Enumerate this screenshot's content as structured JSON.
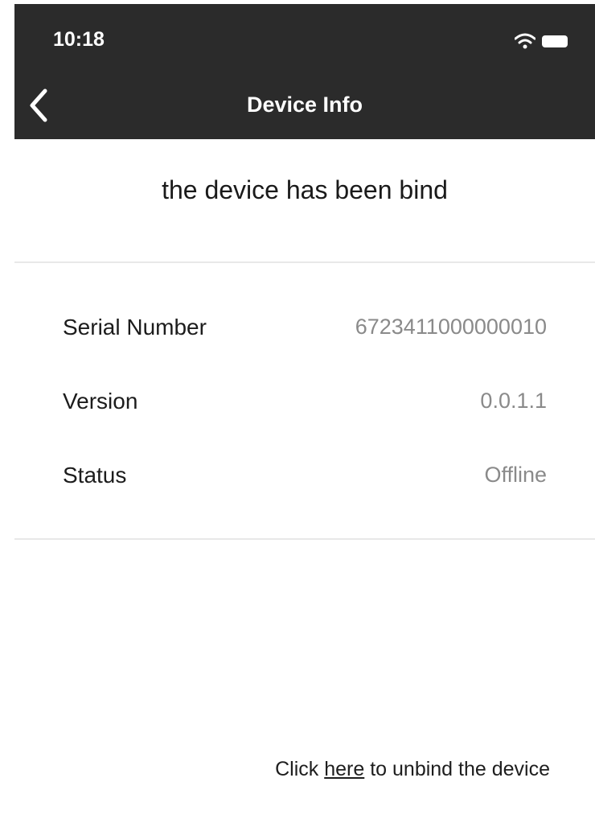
{
  "status_bar": {
    "time": "10:18",
    "icons": [
      "wifi-icon",
      "battery-icon"
    ]
  },
  "nav": {
    "title": "Device Info",
    "back_icon": "chevron-left-icon"
  },
  "headline": "the device has been bind",
  "device_info": {
    "rows": [
      {
        "label": "Serial Number",
        "value": "6723411000000010"
      },
      {
        "label": "Version",
        "value": "0.0.1.1"
      },
      {
        "label": "Status",
        "value": "Offline"
      }
    ]
  },
  "footer": {
    "prefix": "Click ",
    "link": "here",
    "suffix": " to unbind the device"
  },
  "colors": {
    "appbar": "#2b2b2b",
    "value_text": "#8a8a8a",
    "divider": "#e8e8e8"
  }
}
